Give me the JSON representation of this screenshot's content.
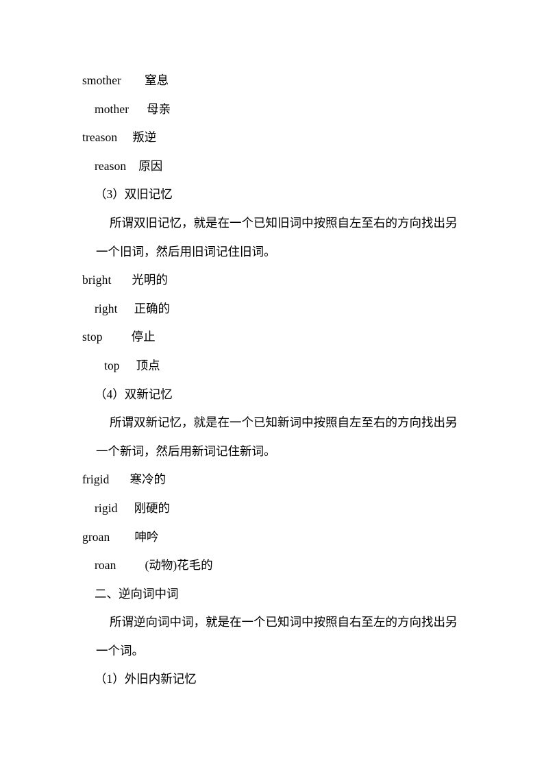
{
  "page": {
    "background_color": "#ffffff",
    "text_color": "#000000"
  },
  "blocks": {
    "pairs_1": [
      {
        "term": "smother",
        "gloss": "窒息"
      },
      {
        "term": "mother",
        "gloss": "母亲"
      },
      {
        "term": "treason",
        "gloss": "叛逆"
      },
      {
        "term": "reason",
        "gloss": "原因"
      }
    ],
    "pairs_2": [
      {
        "term": "bright",
        "gloss": "光明的"
      },
      {
        "term": "right",
        "gloss": "正确的"
      },
      {
        "term": "stop",
        "gloss": "停止"
      },
      {
        "term": "top",
        "gloss": "顶点"
      }
    ],
    "pairs_3": [
      {
        "term": "frigid",
        "gloss": "寒冷的"
      },
      {
        "term": "rigid",
        "gloss": "刚硬的"
      },
      {
        "term": "groan",
        "gloss": "呻吟"
      },
      {
        "term": "roan",
        "gloss": "(动物)花毛的"
      }
    ]
  },
  "section_3": {
    "heading": "（3）双旧记忆",
    "paragraph_line_1": "所谓双旧记忆，就是在一个已知旧词中按照自左至右的方向找出另",
    "paragraph_line_2": "一个旧词，然后用旧词记住旧词。"
  },
  "section_4": {
    "heading": "（4）双新记忆",
    "paragraph_line_1": "所谓双新记忆，就是在一个已知新词中按照自左至右的方向找出另",
    "paragraph_line_2": "一个新词，然后用新词记住新词。"
  },
  "section_two": {
    "heading": "二、逆向词中词",
    "paragraph_line_1": "所谓逆向词中词，就是在一个已知词中按照自右至左的方向找出另",
    "paragraph_line_2": "一个词。",
    "sub_heading": "（1）外旧内新记忆"
  }
}
